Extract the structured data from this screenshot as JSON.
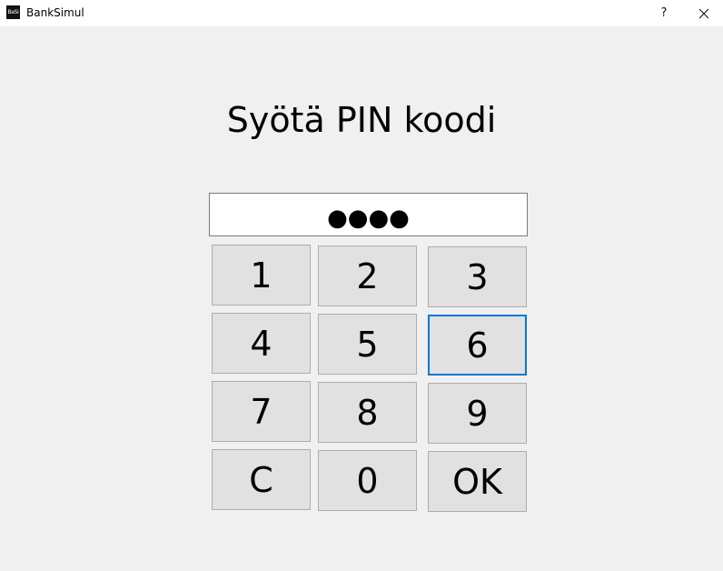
{
  "window": {
    "icon_text": "BaSi",
    "title": "BankSimul",
    "help_label": "?",
    "close_icon": "close-icon"
  },
  "heading": "Syötä PIN koodi",
  "pin_field": {
    "masked_value": "●●●●"
  },
  "keypad": {
    "keys": [
      "1",
      "2",
      "3",
      "4",
      "5",
      "6",
      "7",
      "8",
      "9",
      "C",
      "0",
      "OK"
    ],
    "focused_key": "6"
  },
  "colors": {
    "background": "#f0f0f0",
    "button_face": "#e1e1e1",
    "button_border": "#adadad",
    "focus_border": "#0078d7"
  }
}
